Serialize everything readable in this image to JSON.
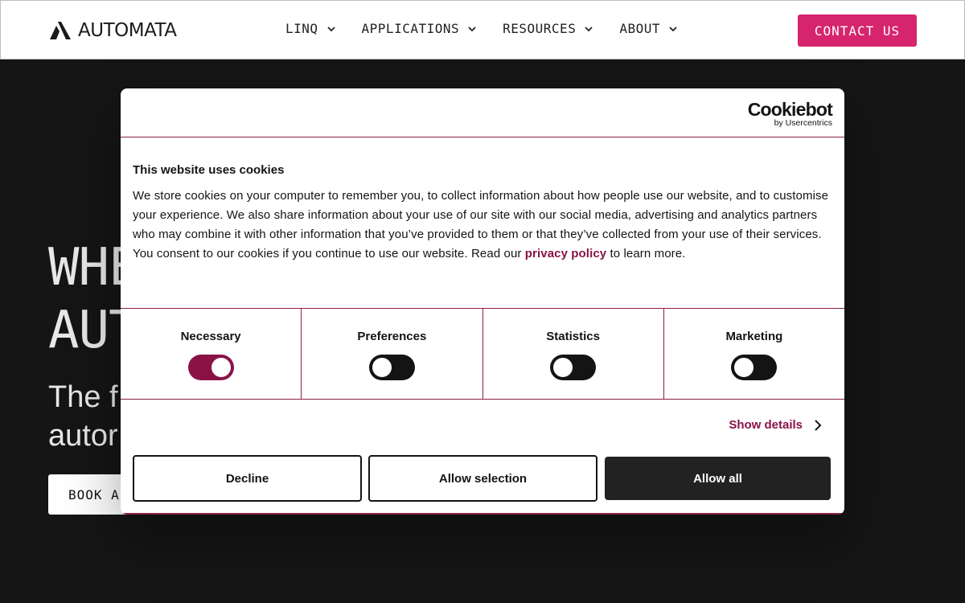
{
  "header": {
    "logo_text": "AUTOMATA",
    "nav": [
      {
        "label": "LINQ"
      },
      {
        "label": "APPLICATIONS"
      },
      {
        "label": "RESOURCES"
      },
      {
        "label": "ABOUT"
      }
    ],
    "contact_label": "CONTACT US"
  },
  "hero": {
    "title_line1": "WHE",
    "title_line2": "AUT",
    "subtitle_line1": "The f",
    "subtitle_line2": "autor",
    "cta_label": "BOOK A"
  },
  "cookie_dialog": {
    "brand": "Cookiebot",
    "brand_by": "by Usercentrics",
    "title": "This website uses cookies",
    "body_text": "We store cookies on your computer to remember you, to collect information about how people use our website, and to customise your experience. We also share information about your use of our site with our social media, advertising and analytics partners who may combine it with other information that you’ve provided to them or that they’ve collected from your use of their services. You consent to our cookies if you continue to use our website. Read our ",
    "privacy_link": "privacy policy",
    "body_tail": " to learn more.",
    "toggles": [
      {
        "label": "Necessary",
        "on": true
      },
      {
        "label": "Preferences",
        "on": false
      },
      {
        "label": "Statistics",
        "on": false
      },
      {
        "label": "Marketing",
        "on": false
      }
    ],
    "show_details": "Show details",
    "decline": "Decline",
    "allow_selection": "Allow selection",
    "allow_all": "Allow all"
  },
  "colors": {
    "accent_pink": "#d6246e",
    "cookiebot_accent": "#8a1247",
    "page_bg": "#151515"
  }
}
